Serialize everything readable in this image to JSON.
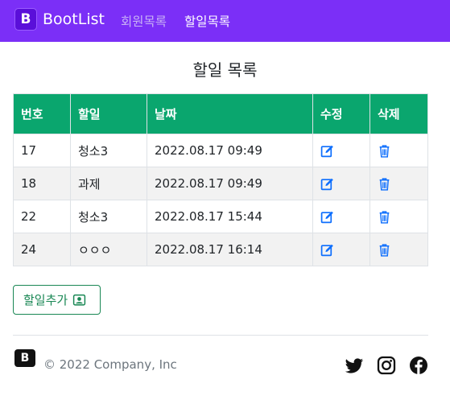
{
  "navbar": {
    "brand_logo": "B",
    "brand_name": "BootList",
    "links": [
      "회원목록",
      "할일목록"
    ]
  },
  "page": {
    "title": "할일 목록"
  },
  "table": {
    "headers": [
      "번호",
      "할일",
      "날짜",
      "수정",
      "삭제"
    ],
    "rows": [
      {
        "id": "17",
        "task": "청소3",
        "date": "2022.08.17 09:49"
      },
      {
        "id": "18",
        "task": "과제",
        "date": "2022.08.17 09:49"
      },
      {
        "id": "22",
        "task": "청소3",
        "date": "2022.08.17 15:44"
      },
      {
        "id": "24",
        "task": "ㅇㅇㅇ",
        "date": "2022.08.17 16:14"
      }
    ],
    "edit_icon": "pencil-square-icon",
    "delete_icon": "trash-icon"
  },
  "actions": {
    "add_label": "할일추가",
    "add_icon": "person-badge-icon"
  },
  "footer": {
    "logo": "B",
    "copyright": "© 2022 Company, Inc",
    "social_icons": [
      "twitter-icon",
      "instagram-icon",
      "facebook-icon"
    ]
  },
  "colors": {
    "navbar": "#7b2ff7",
    "table_header": "#0aa66e",
    "icon_blue": "#0d6efd",
    "success": "#198754"
  }
}
